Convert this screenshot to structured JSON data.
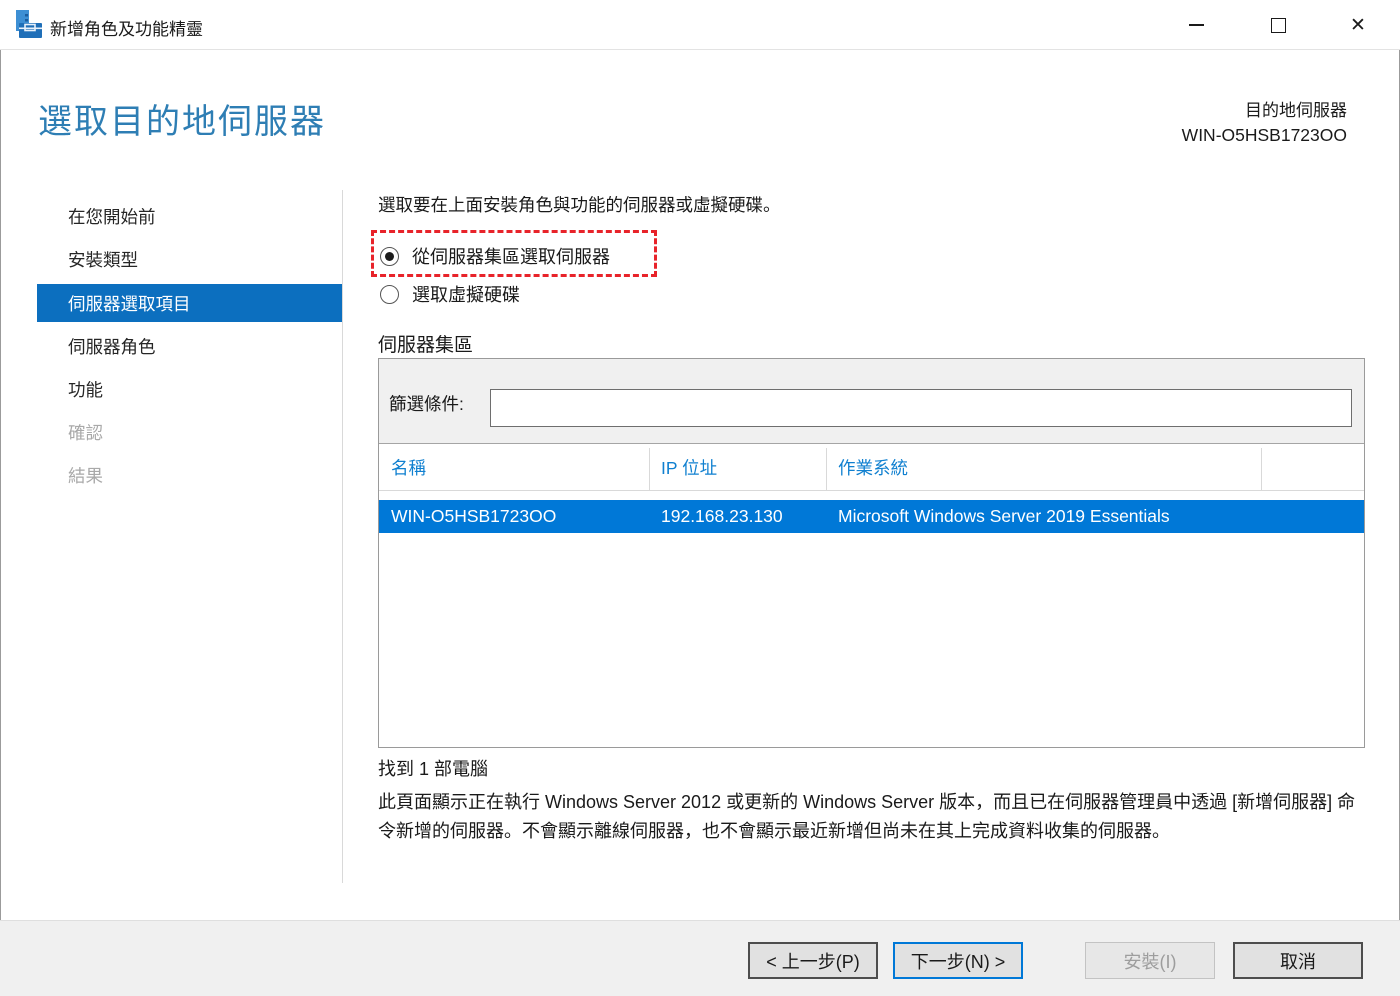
{
  "window": {
    "title": "新增角色及功能精靈",
    "icons": {
      "app": "server-manager-toolbox",
      "minimize": "minimize",
      "maximize": "maximize",
      "close": "close"
    }
  },
  "header": {
    "page_title": "選取目的地伺服器",
    "destination_label": "目的地伺服器",
    "destination_server": "WIN-O5HSB1723OO"
  },
  "sidebar": {
    "items": [
      {
        "label": "在您開始前",
        "state": "enabled"
      },
      {
        "label": "安裝類型",
        "state": "enabled"
      },
      {
        "label": "伺服器選取項目",
        "state": "selected"
      },
      {
        "label": "伺服器角色",
        "state": "enabled"
      },
      {
        "label": "功能",
        "state": "enabled"
      },
      {
        "label": "確認",
        "state": "disabled"
      },
      {
        "label": "結果",
        "state": "disabled"
      }
    ]
  },
  "main": {
    "instruction": "選取要在上面安裝角色與功能的伺服器或虛擬硬碟。",
    "radios": [
      {
        "label": "從伺服器集區選取伺服器",
        "selected": true,
        "annotated": true
      },
      {
        "label": "選取虛擬硬碟",
        "selected": false,
        "annotated": false
      }
    ],
    "annotation_color": "#e8232a",
    "server_pool": {
      "section_label": "伺服器集區",
      "filter_label": "篩選條件:",
      "filter_value": "",
      "table": {
        "columns": [
          "名稱",
          "IP 位址",
          "作業系統"
        ],
        "rows": [
          {
            "name": "WIN-O5HSB1723OO",
            "ip": "192.168.23.130",
            "os": "Microsoft Windows Server 2019 Essentials"
          }
        ],
        "selected_row_index": 0
      },
      "found_text": "找到 1 部電腦"
    },
    "description": "此頁面顯示正在執行 Windows Server 2012 或更新的 Windows Server 版本，而且已在伺服器管理員中透過 [新增伺服器] 命令新增的伺服器。不會顯示離線伺服器，也不會顯示最近新增但尚未在其上完成資料收集的伺服器。"
  },
  "footer": {
    "buttons": [
      {
        "label": "< 上一步(P)",
        "state": "enabled"
      },
      {
        "label": "下一步(N) >",
        "state": "default"
      },
      {
        "label": "安裝(I)",
        "state": "disabled"
      },
      {
        "label": "取消",
        "state": "enabled"
      }
    ]
  },
  "colors": {
    "title_blue": "#2e7eb4",
    "sidebar_selected_bg": "#0c6fbf",
    "row_selected_bg": "#0078d7",
    "table_header_text": "#1080d0",
    "annotation_red": "#e8232a",
    "footer_bg": "#f0f0f0",
    "default_button_border": "#0078d7"
  }
}
